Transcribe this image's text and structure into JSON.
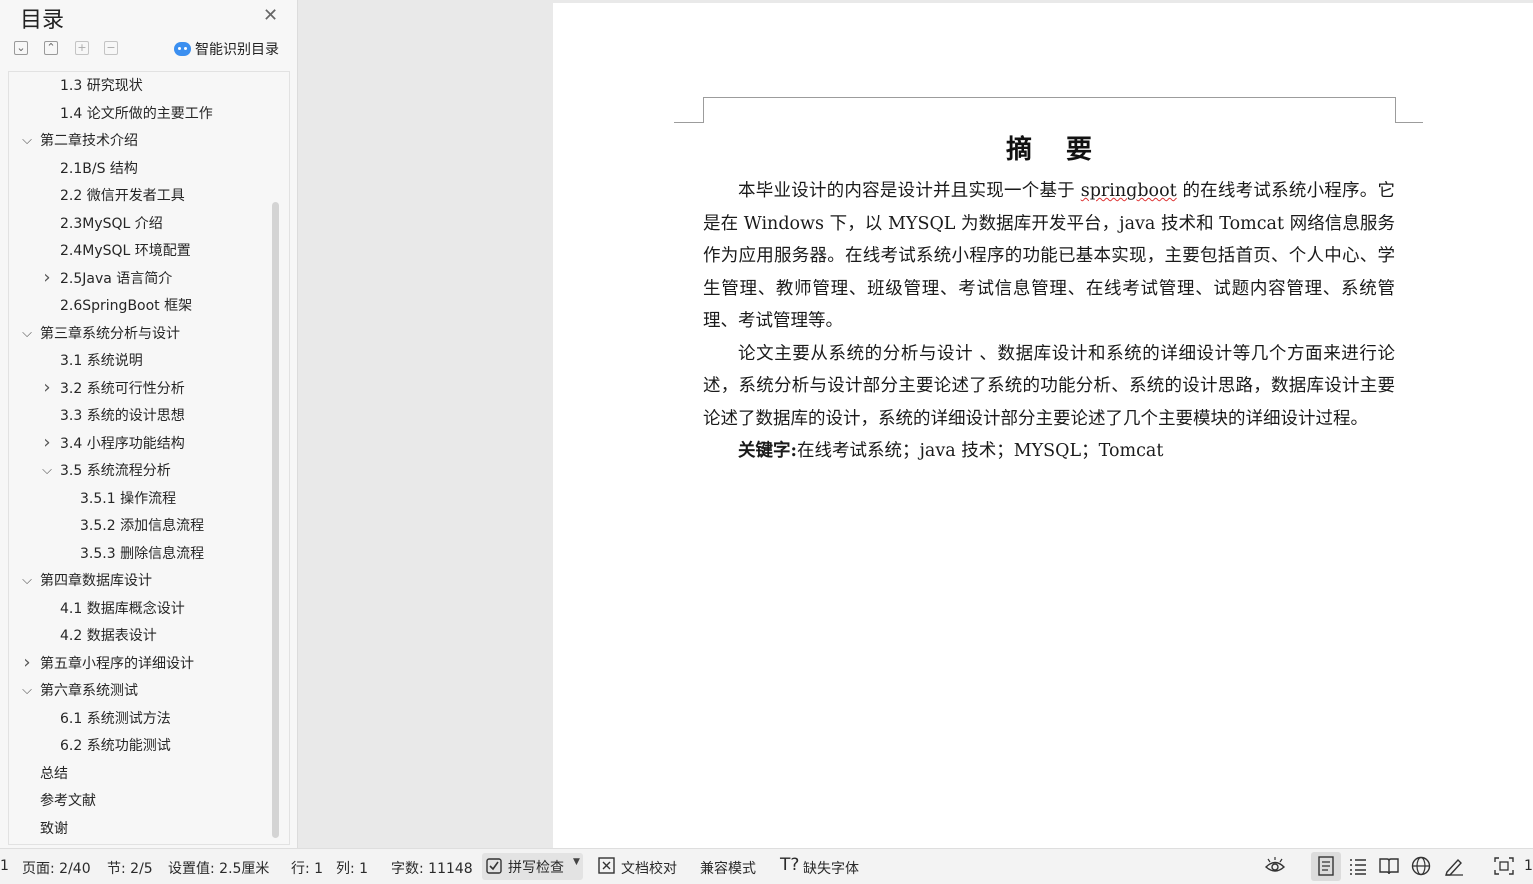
{
  "sidebar": {
    "title": "目录",
    "close_icon": "close-icon",
    "smart_label": "智能识别目录",
    "toolbar_icons": [
      "expand-all-icon",
      "collapse-all-icon",
      "add-heading-icon",
      "remove-heading-icon"
    ],
    "items": [
      {
        "text": "1.3  研究现状",
        "level": 2,
        "chevron": "none"
      },
      {
        "text": "1.4 论文所做的主要工作",
        "level": 2,
        "chevron": "none"
      },
      {
        "text": "第二章技术介绍",
        "level": 1,
        "chevron": "down"
      },
      {
        "text": "2.1B/S 结构",
        "level": 2,
        "chevron": "none"
      },
      {
        "text": "2.2 微信开发者工具",
        "level": 2,
        "chevron": "none"
      },
      {
        "text": "2.3MySQL 介绍",
        "level": 2,
        "chevron": "none"
      },
      {
        "text": "2.4MySQL 环境配置",
        "level": 2,
        "chevron": "none"
      },
      {
        "text": "2.5Java 语言简介",
        "level": 2,
        "chevron": "right"
      },
      {
        "text": "2.6SpringBoot 框架",
        "level": 2,
        "chevron": "none"
      },
      {
        "text": "第三章系统分析与设计",
        "level": 1,
        "chevron": "down"
      },
      {
        "text": "3.1 系统说明",
        "level": 2,
        "chevron": "none"
      },
      {
        "text": "3.2 系统可行性分析",
        "level": 2,
        "chevron": "right"
      },
      {
        "text": "3.3 系统的设计思想",
        "level": 2,
        "chevron": "none"
      },
      {
        "text": "3.4 小程序功能结构",
        "level": 2,
        "chevron": "right"
      },
      {
        "text": "3.5 系统流程分析",
        "level": 2,
        "chevron": "down"
      },
      {
        "text": "3.5.1 操作流程",
        "level": 3,
        "chevron": "none"
      },
      {
        "text": "3.5.2 添加信息流程",
        "level": 3,
        "chevron": "none"
      },
      {
        "text": "3.5.3 删除信息流程",
        "level": 3,
        "chevron": "none"
      },
      {
        "text": "第四章数据库设计",
        "level": 1,
        "chevron": "down"
      },
      {
        "text": "4.1 数据库概念设计",
        "level": 2,
        "chevron": "none"
      },
      {
        "text": "4.2 数据表设计",
        "level": 2,
        "chevron": "none"
      },
      {
        "text": "第五章小程序的详细设计",
        "level": 1,
        "chevron": "right"
      },
      {
        "text": "第六章系统测试",
        "level": 1,
        "chevron": "down"
      },
      {
        "text": "6.1 系统测试方法",
        "level": 2,
        "chevron": "none"
      },
      {
        "text": "6.2 系统功能测试",
        "level": 2,
        "chevron": "none"
      },
      {
        "text": "总结",
        "level": 1,
        "chevron": "none"
      },
      {
        "text": "参考文献",
        "level": 1,
        "chevron": "none"
      },
      {
        "text": "致谢",
        "level": 1,
        "chevron": "none"
      }
    ]
  },
  "document": {
    "heading": "摘要",
    "p1_a": "本毕业设计的内容是设计并且实现一个基于 ",
    "p1_spell": "springboot",
    "p1_b": " 的在线考试系统小程序。它是在 Windows 下，以 MYSQL 为数据库开发平台，java 技术和 Tomcat 网络信息服务作为应用服务器。在线考试系统小程序的功能已基本实现，主要包括首页、个人中心、学生管理、教师管理、班级管理、考试信息管理、在线考试管理、试题内容管理、系统管理、考试管理等。",
    "p2": "论文主要从系统的分析与设计 、数据库设计和系统的详细设计等几个方面来进行论述，系统分析与设计部分主要论述了系统的功能分析、系统的设计思路，数据库设计主要论述了数据库的设计，系统的详细设计部分主要论述了几个主要模块的详细设计过程。",
    "keywords_label": "关键字:",
    "keywords": "在线考试系统；java 技术；MYSQL；Tomcat"
  },
  "statusbar": {
    "edge_left": "1",
    "page": "页面: 2/40",
    "section": "节: 2/5",
    "setting": "设置值: 2.5厘米",
    "row": "行: 1",
    "col": "列: 1",
    "words": "字数: 11148",
    "spellcheck": "拼写检查",
    "doc_check": "文档校对",
    "compat": "兼容模式",
    "missing_font": "缺失字体",
    "edge_right": "1",
    "view_icons": [
      "eye-protection-icon",
      "page-view-icon",
      "outline-view-icon",
      "reading-view-icon",
      "web-view-icon",
      "write-mode-icon",
      "fullscreen-icon"
    ]
  }
}
